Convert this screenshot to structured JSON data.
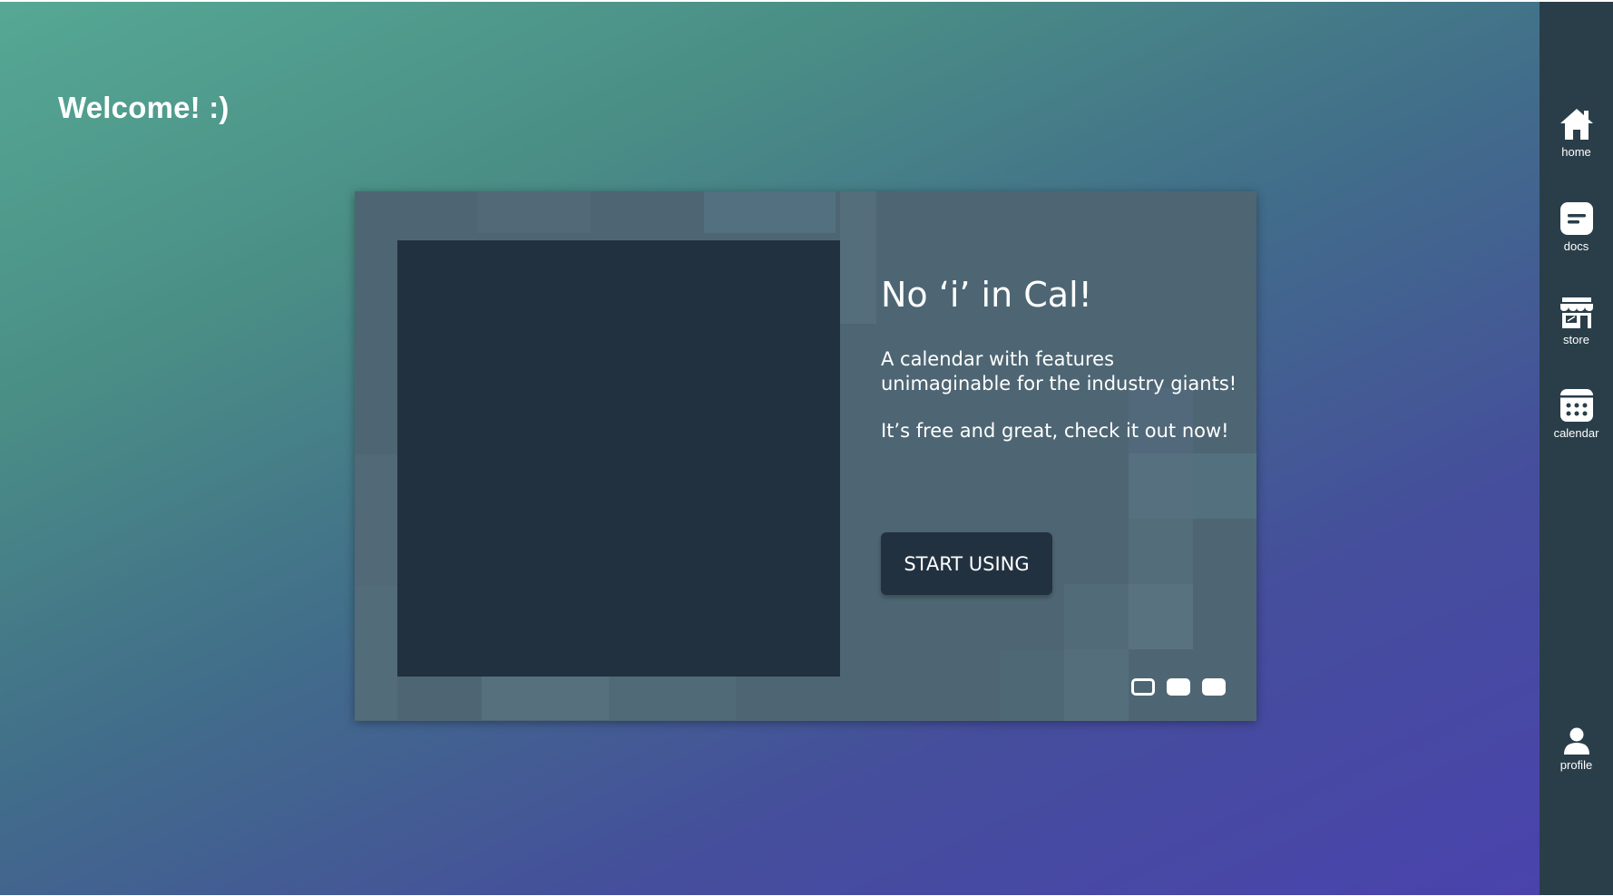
{
  "header": {
    "welcome": "Welcome! :)"
  },
  "hero": {
    "title": "No ‘i’ in Cal!",
    "description": "A calendar with features unimaginable for the industry giants!",
    "tagline": "It’s free and great, check it out now!",
    "cta_label": "START USING",
    "carousel": {
      "slide_count": 3,
      "active_index": 0
    }
  },
  "sidebar": {
    "items": [
      {
        "label": "home",
        "icon": "home-icon"
      },
      {
        "label": "docs",
        "icon": "docs-icon"
      },
      {
        "label": "store",
        "icon": "store-icon"
      },
      {
        "label": "calendar",
        "icon": "calendar-icon"
      }
    ],
    "profile": {
      "label": "profile",
      "icon": "profile-icon"
    }
  },
  "colors": {
    "background_start": "#56a894",
    "background_end": "#4a42ae",
    "card": "#4e6673",
    "dark": "#213140",
    "sidebar": "#2a3e49",
    "text": "#ffffff"
  }
}
